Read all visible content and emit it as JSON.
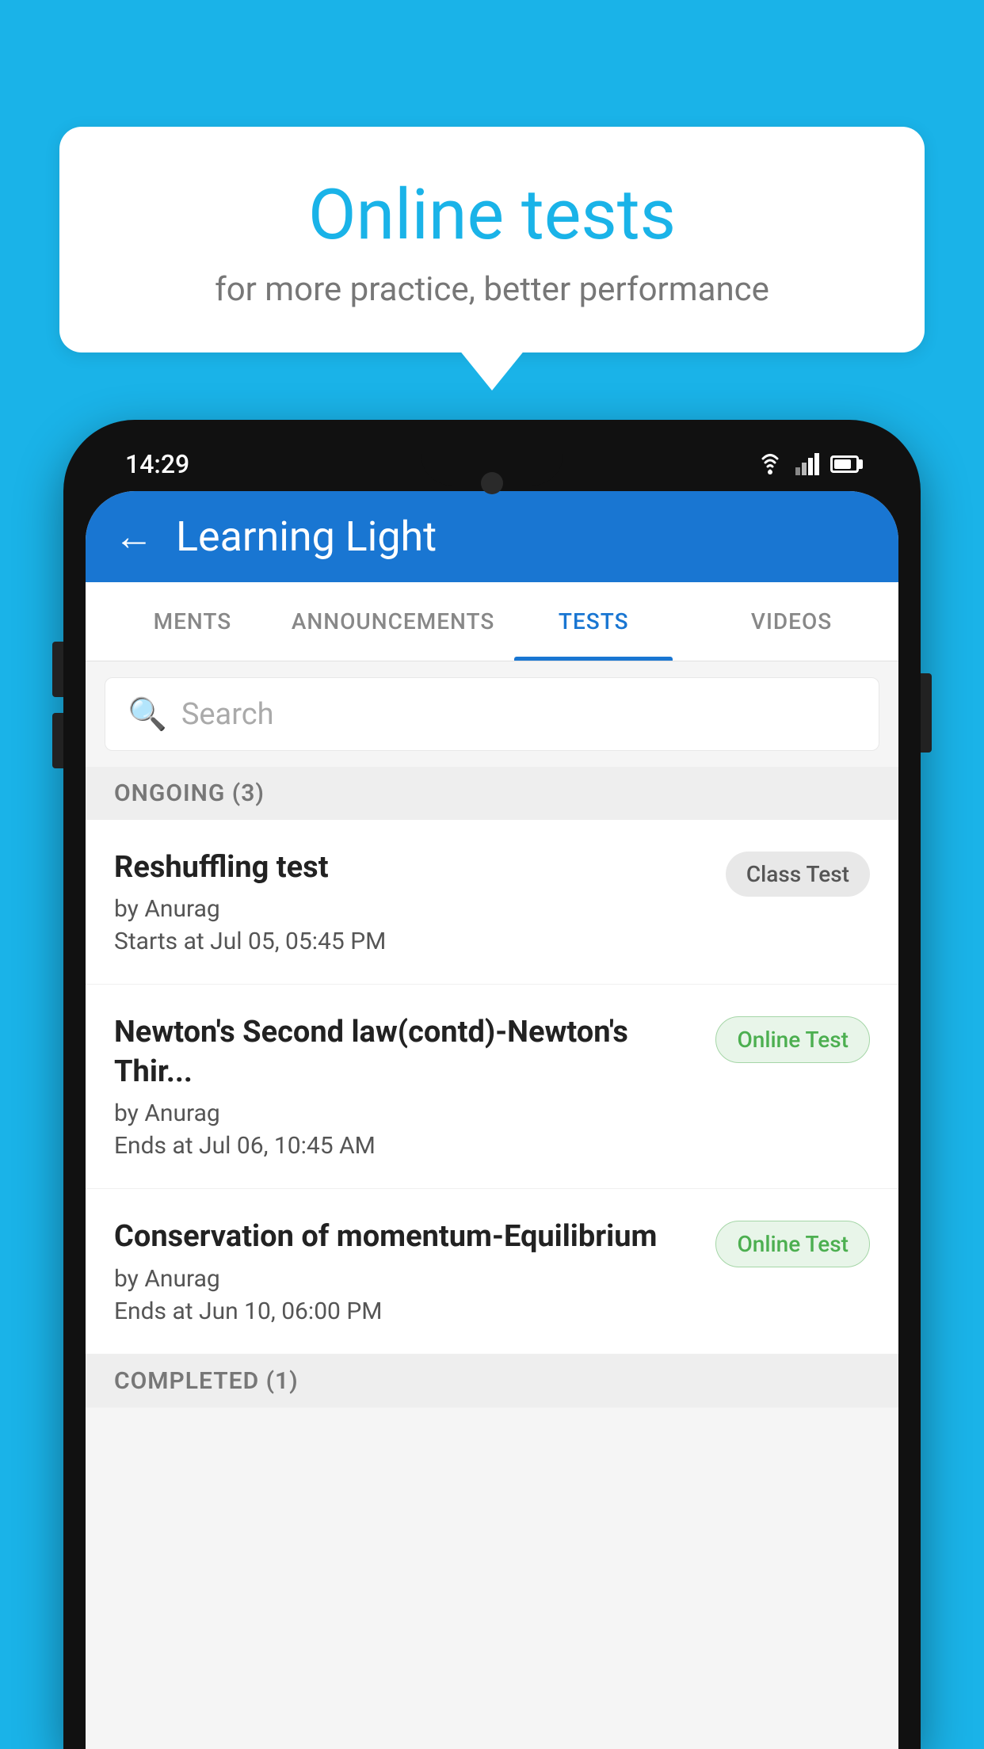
{
  "background_color": "#1ab3e8",
  "speech_bubble": {
    "title": "Online tests",
    "subtitle": "for more practice, better performance"
  },
  "phone": {
    "status_bar": {
      "time": "14:29"
    },
    "app_header": {
      "title": "Learning Light",
      "back_label": "←"
    },
    "tabs": [
      {
        "label": "MENTS",
        "active": false
      },
      {
        "label": "ANNOUNCEMENTS",
        "active": false
      },
      {
        "label": "TESTS",
        "active": true
      },
      {
        "label": "VIDEOS",
        "active": false
      }
    ],
    "search": {
      "placeholder": "Search"
    },
    "sections": [
      {
        "title": "ONGOING (3)",
        "items": [
          {
            "name": "Reshuffling test",
            "author": "by Anurag",
            "time": "Starts at  Jul 05, 05:45 PM",
            "badge": "Class Test",
            "badge_type": "class"
          },
          {
            "name": "Newton's Second law(contd)-Newton's Thir...",
            "author": "by Anurag",
            "time": "Ends at  Jul 06, 10:45 AM",
            "badge": "Online Test",
            "badge_type": "online"
          },
          {
            "name": "Conservation of momentum-Equilibrium",
            "author": "by Anurag",
            "time": "Ends at  Jun 10, 06:00 PM",
            "badge": "Online Test",
            "badge_type": "online"
          }
        ]
      },
      {
        "title": "COMPLETED (1)",
        "items": []
      }
    ]
  }
}
